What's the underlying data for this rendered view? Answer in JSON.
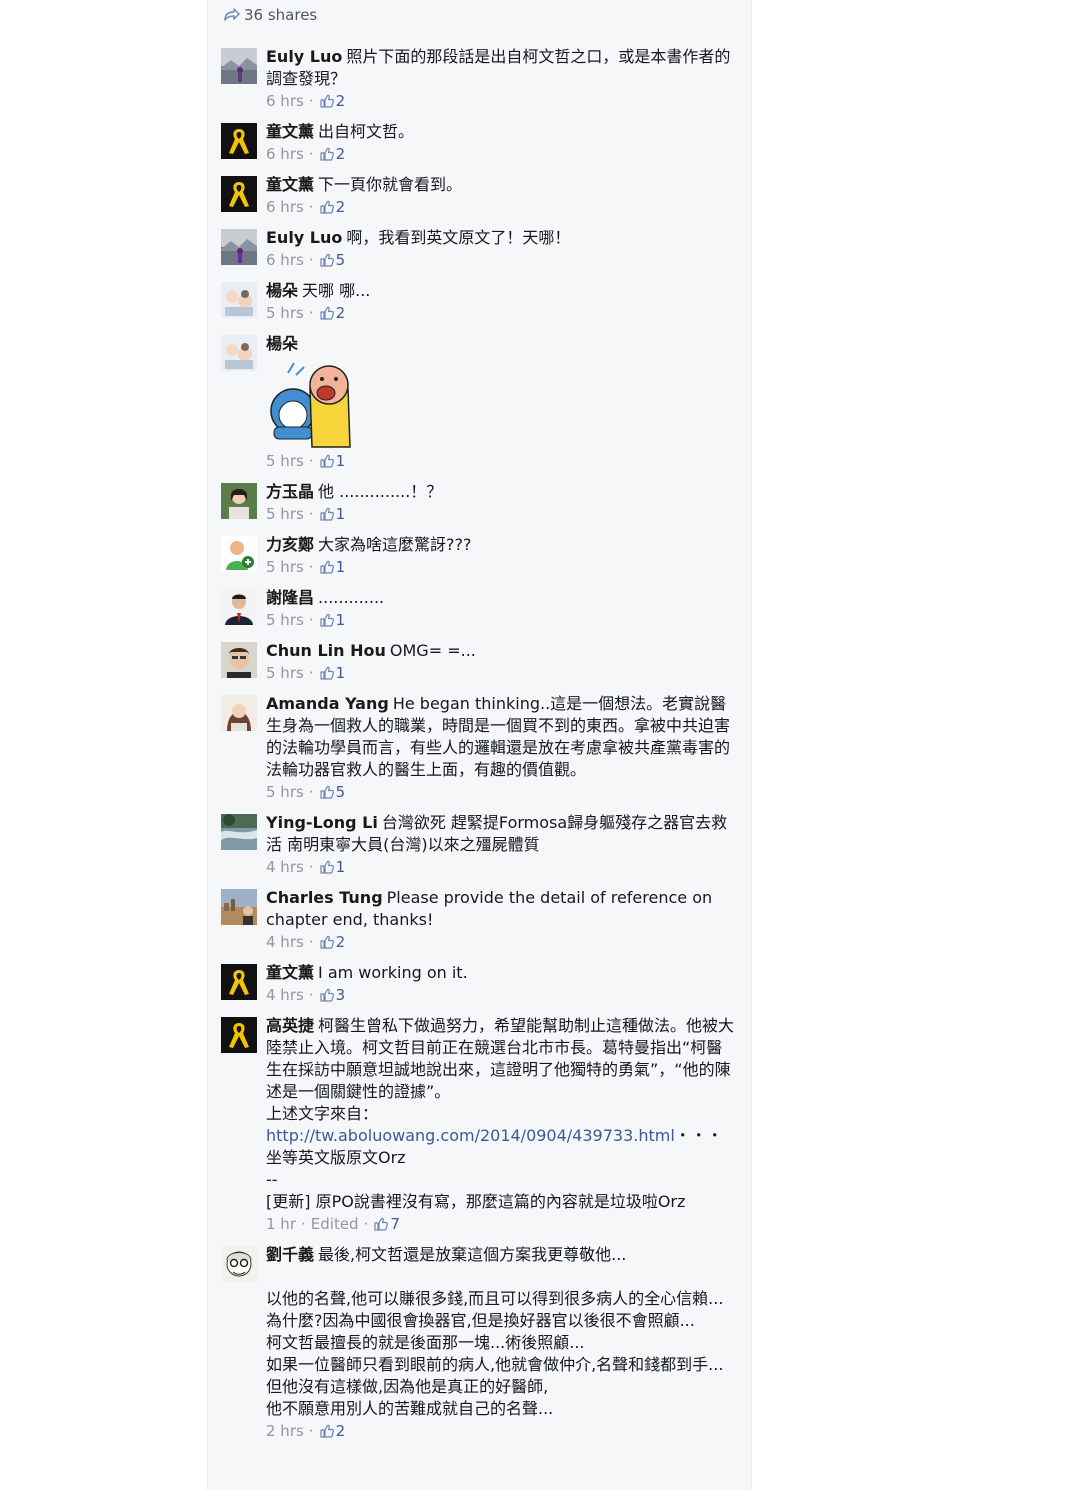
{
  "shares": {
    "label": "36 shares"
  },
  "comments": [
    {
      "author": "Euly Luo",
      "text": "照片下面的那段話是出自柯文哲之口，或是本書作者的調查發現？",
      "time": "6 hrs",
      "likes": "2",
      "avatar": "photo-landscape"
    },
    {
      "author": "童文薰",
      "text": "出自柯文哲。",
      "time": "6 hrs",
      "likes": "2",
      "avatar": "yellow-ribbon"
    },
    {
      "author": "童文薰",
      "text": "下一頁你就會看到。",
      "time": "6 hrs",
      "likes": "2",
      "avatar": "yellow-ribbon"
    },
    {
      "author": "Euly Luo",
      "text": "啊，我看到英文原文了！天哪！",
      "time": "6 hrs",
      "likes": "5",
      "avatar": "photo-landscape"
    },
    {
      "author": "楊朵",
      "text": "天哪 哪...",
      "time": "5 hrs",
      "likes": "2",
      "avatar": "photo-cartoon"
    },
    {
      "author": "楊朵",
      "text": "",
      "time": "5 hrs",
      "likes": "1",
      "avatar": "photo-cartoon",
      "sticker": "shouting-cartoon-sticker"
    },
    {
      "author": "方玉晶",
      "text": "他 ..............！？",
      "time": "5 hrs",
      "likes": "1",
      "avatar": "photo-portrait"
    },
    {
      "author": "力亥鄭",
      "text": "大家為啥這麼驚訝???",
      "time": "5 hrs",
      "likes": "1",
      "avatar": "default-user"
    },
    {
      "author": "謝隆昌",
      "text": ".............",
      "time": "5 hrs",
      "likes": "1",
      "avatar": "photo-suit"
    },
    {
      "author": "Chun Lin Hou",
      "text": "OMG= =...",
      "time": "5 hrs",
      "likes": "1",
      "avatar": "photo-face"
    },
    {
      "author": "Amanda Yang",
      "text": "He began thinking..這是一個想法。老實說醫生身為一個救人的職業，時間是一個買不到的東西。拿被中共迫害的法輪功學員而言，有些人的邏輯還是放在考慮拿被共產黨毒害的法輪功器官救人的醫生上面，有趣的價值觀。",
      "time": "5 hrs",
      "likes": "5",
      "avatar": "photo-woman"
    },
    {
      "author": "Ying-Long Li",
      "text": "台灣欲死 趕緊提Formosa歸身軀殘存之器官去救活 南明東寧大員(台灣)以來之殭屍體質",
      "time": "4 hrs",
      "likes": "1",
      "avatar": "photo-water"
    },
    {
      "author": "Charles Tung",
      "text": "Please provide the detail of reference on chapter end, thanks!",
      "time": "4 hrs",
      "likes": "2",
      "avatar": "photo-city"
    },
    {
      "author": "童文薰",
      "text": "I am working on it.",
      "time": "4 hrs",
      "likes": "3",
      "avatar": "yellow-ribbon"
    },
    {
      "author": "高英捷",
      "text": "柯醫生曾私下做過努力，希望能幫助制止這種做法。他被大陸禁止入境。柯文哲目前正在競選台北市市長。葛特曼指出“柯醫生在採訪中願意坦誠地說出來，這證明了他獨特的勇氣”，“他的陳述是一個關鍵性的證據”。",
      "text2_prefix": "上述文字來自：",
      "link": "http://tw.aboluowang.com/2014/0904/439733.html",
      "link_suffix": "・・・",
      "text3": "坐等英文版原文Orz\n--\n[更新] 原PO說書裡沒有寫，那麼這篇的內容就是垃圾啦Orz",
      "time": "1 hr",
      "edited": "Edited",
      "likes": "7",
      "avatar": "yellow-ribbon"
    },
    {
      "author": "劉千義",
      "text": "最後,柯文哲還是放棄這個方案我更尊敬他...\n\n以他的名聲,他可以賺很多錢,而且可以得到很多病人的全心信賴...\n為什麼?因為中國很會換器官,但是換好器官以後很不會照顧...\n柯文哲最擅長的就是後面那一塊...術後照顧...\n如果一位醫師只看到眼前的病人,他就會做仲介,名聲和錢都到手...\n但他沒有這樣做,因為他是真正的好醫師,\n他不願意用別人的苦難成就自己的名聲...",
      "time": "2 hrs",
      "likes": "2",
      "avatar": "photo-cartoon-glasses"
    }
  ]
}
